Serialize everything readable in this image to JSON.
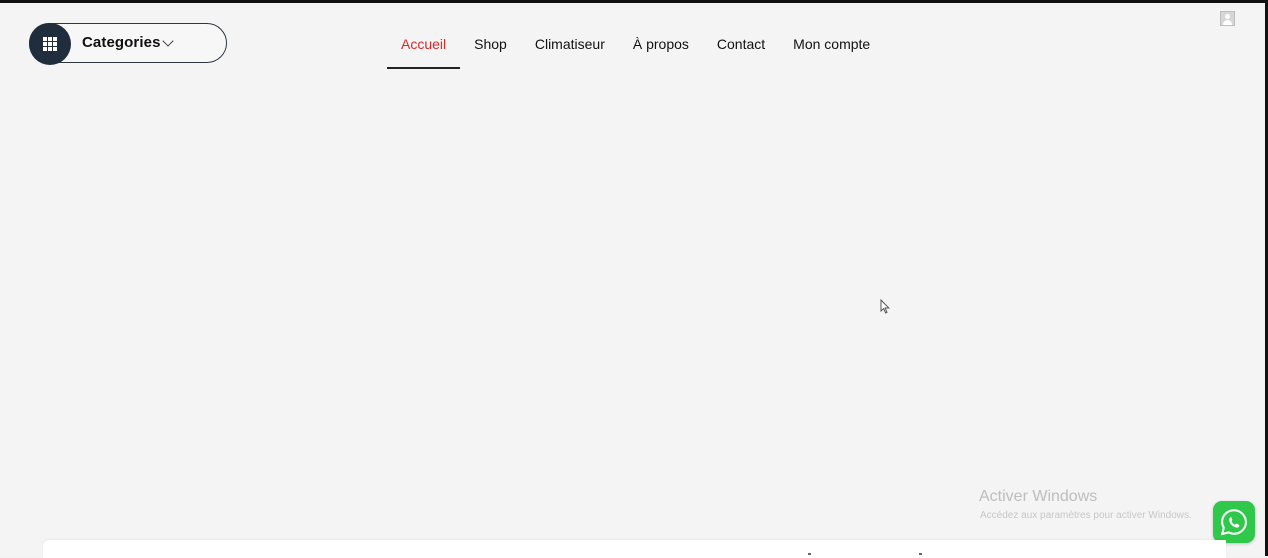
{
  "header": {
    "categories_label": "Categories",
    "nav": [
      {
        "label": "Accueil",
        "active": true
      },
      {
        "label": "Shop",
        "active": false
      },
      {
        "label": "Climatiseur",
        "active": false
      },
      {
        "label": "À propos",
        "active": false
      },
      {
        "label": "Contact",
        "active": false
      },
      {
        "label": "Mon compte",
        "active": false
      }
    ]
  },
  "overlay": {
    "windows_title": "Activer Windows",
    "windows_subtitle": "Accédez aux paramètres pour activer Windows."
  },
  "icons": {
    "categories": "grid-icon",
    "account": "user-icon",
    "whatsapp": "whatsapp-icon"
  },
  "colors": {
    "active_nav": "#d52a2a",
    "categories_icon_bg": "#1f2d3d",
    "whatsapp": "#2fc84b"
  }
}
